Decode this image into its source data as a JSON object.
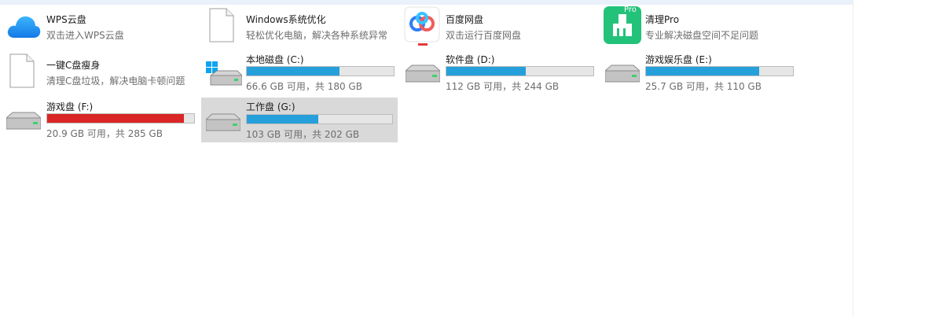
{
  "colors": {
    "bar_blue": "#26a0da",
    "bar_red": "#da2626",
    "selected_bg": "#d9d9d9"
  },
  "apps": [
    {
      "name": "WPS云盘",
      "desc": "双击进入WPS云盘",
      "icon": "wps-cloud-icon"
    },
    {
      "name": "Windows系统优化",
      "desc": "轻松优化电脑，解决各种系统异常",
      "icon": "blank-document-icon"
    },
    {
      "name": "百度网盘",
      "desc": "双击运行百度网盘",
      "icon": "baidu-netdisk-icon"
    },
    {
      "name": "清理Pro",
      "desc": "专业解决磁盘空间不足问题",
      "icon": "cleaner-pro-icon",
      "badge": "Pro"
    },
    {
      "name": "一键C盘瘦身",
      "desc": "清理C盘垃圾，解决电脑卡顿问题",
      "icon": "blank-document-icon"
    }
  ],
  "drives": [
    {
      "name": "本地磁盘 (C:)",
      "usage": "66.6 GB 可用，共 180 GB",
      "used_fraction": 0.63,
      "status": "normal",
      "icon": "windows-drive-icon"
    },
    {
      "name": "软件盘 (D:)",
      "usage": "112 GB 可用，共 244 GB",
      "used_fraction": 0.54,
      "status": "normal",
      "icon": "hard-drive-icon"
    },
    {
      "name": "游戏娱乐盘 (E:)",
      "usage": "25.7 GB 可用，共 110 GB",
      "used_fraction": 0.77,
      "status": "normal",
      "icon": "hard-drive-icon"
    },
    {
      "name": "游戏盘 (F:)",
      "usage": "20.9 GB 可用，共 285 GB",
      "used_fraction": 0.93,
      "status": "critical",
      "icon": "hard-drive-icon"
    },
    {
      "name": "工作盘 (G:)",
      "usage": "103 GB 可用，共 202 GB",
      "used_fraction": 0.49,
      "status": "normal",
      "icon": "hard-drive-icon",
      "selected": true
    }
  ]
}
